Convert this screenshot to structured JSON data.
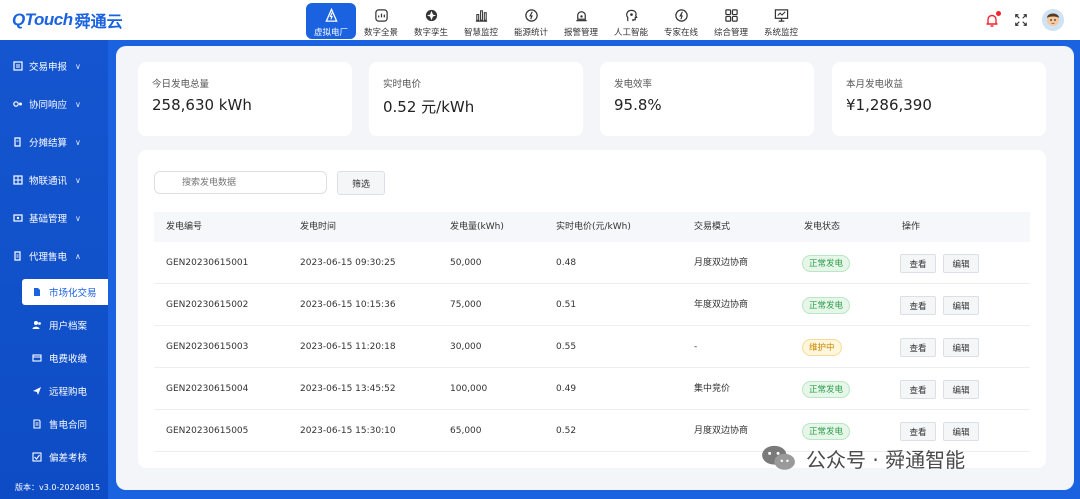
{
  "brand": {
    "logo_latin": "QTouch",
    "logo_cn": "舜通云"
  },
  "nav": [
    {
      "label": "虚拟电厂",
      "icon": "power-plant-icon",
      "active": true
    },
    {
      "label": "数字全景",
      "icon": "panorama-icon",
      "active": false
    },
    {
      "label": "数字孪生",
      "icon": "twin-icon",
      "active": false
    },
    {
      "label": "智慧监控",
      "icon": "bar-chart-icon",
      "active": false
    },
    {
      "label": "能源统计",
      "icon": "energy-icon",
      "active": false
    },
    {
      "label": "报警管理",
      "icon": "alarm-icon",
      "active": false
    },
    {
      "label": "人工智能",
      "icon": "ai-head-icon",
      "active": false
    },
    {
      "label": "专家在线",
      "icon": "expert-icon",
      "active": false
    },
    {
      "label": "综合管理",
      "icon": "grid-icon",
      "active": false
    },
    {
      "label": "系统监控",
      "icon": "monitor-icon",
      "active": false
    }
  ],
  "sidebar": {
    "groups": [
      {
        "label": "交易申报",
        "icon": "declare-icon",
        "expanded": false
      },
      {
        "label": "协同响应",
        "icon": "sync-icon",
        "expanded": false
      },
      {
        "label": "分摊结算",
        "icon": "settle-icon",
        "expanded": false
      },
      {
        "label": "物联通讯",
        "icon": "iot-icon",
        "expanded": false
      },
      {
        "label": "基础管理",
        "icon": "base-icon",
        "expanded": false
      },
      {
        "label": "代理售电",
        "icon": "agent-icon",
        "expanded": true
      }
    ],
    "sub_items": [
      {
        "label": "市场化交易",
        "icon": "document-icon",
        "active": true
      },
      {
        "label": "用户档案",
        "icon": "users-icon",
        "active": false
      },
      {
        "label": "电费收缴",
        "icon": "bill-icon",
        "active": false
      },
      {
        "label": "远程购电",
        "icon": "send-icon",
        "active": false
      },
      {
        "label": "售电合同",
        "icon": "contract-icon",
        "active": false
      },
      {
        "label": "偏差考核",
        "icon": "check-icon",
        "active": false
      }
    ],
    "version": "版本：v3.0-20240815"
  },
  "stats": [
    {
      "title": "今日发电总量",
      "value": "258,630 kWh"
    },
    {
      "title": "实时电价",
      "value": "0.52 元/kWh"
    },
    {
      "title": "发电效率",
      "value": "95.8%"
    },
    {
      "title": "本月发电收益",
      "value": "¥1,286,390"
    }
  ],
  "search": {
    "placeholder": "搜索发电数据"
  },
  "filter_label": "筛选",
  "table": {
    "headers": [
      "发电编号",
      "发电时间",
      "发电量(kWh)",
      "实时电价(元/kWh)",
      "交易模式",
      "发电状态",
      "操作"
    ],
    "rows": [
      {
        "id": "GEN20230615001",
        "time": "2023-06-15 09:30:25",
        "amount": "50,000",
        "price": "0.48",
        "mode": "月度双边协商",
        "status": "正常发电",
        "status_type": "ok"
      },
      {
        "id": "GEN20230615002",
        "time": "2023-06-15 10:15:36",
        "amount": "75,000",
        "price": "0.51",
        "mode": "年度双边协商",
        "status": "正常发电",
        "status_type": "ok"
      },
      {
        "id": "GEN20230615003",
        "time": "2023-06-15 11:20:18",
        "amount": "30,000",
        "price": "0.55",
        "mode": "-",
        "status": "维护中",
        "status_type": "warn"
      },
      {
        "id": "GEN20230615004",
        "time": "2023-06-15 13:45:52",
        "amount": "100,000",
        "price": "0.49",
        "mode": "集中竞价",
        "status": "正常发电",
        "status_type": "ok"
      },
      {
        "id": "GEN20230615005",
        "time": "2023-06-15 15:30:10",
        "amount": "65,000",
        "price": "0.52",
        "mode": "月度双边协商",
        "status": "正常发电",
        "status_type": "ok"
      }
    ],
    "view_label": "查看",
    "edit_label": "编辑"
  },
  "watermark": "公众号 · 舜通智能",
  "colors": {
    "primary": "#1a62e0",
    "ok": "#2e9d49",
    "warn": "#c98a00",
    "alert_dot": "#f5222d"
  }
}
